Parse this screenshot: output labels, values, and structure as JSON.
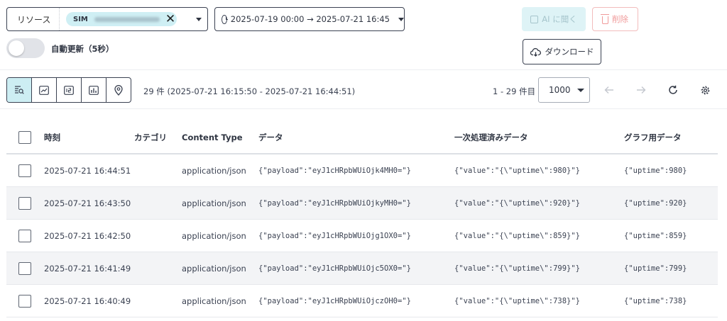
{
  "filters": {
    "resource_label": "リソース",
    "resource_chip": "SIM",
    "date_range": "2025-07-19 00:00 → 2025-07-21 16:45",
    "auto_refresh_label": "自動更新（5秒）",
    "auto_refresh_on": false
  },
  "actions": {
    "ai_label": "AI に聞く",
    "delete_label": "削除",
    "download_label": "ダウンロード"
  },
  "toolbar": {
    "views": [
      {
        "icon": "log-search-icon",
        "active": true
      },
      {
        "icon": "line-chart-icon",
        "active": false
      },
      {
        "icon": "number-card-icon",
        "active": false
      },
      {
        "icon": "bar-chart-icon",
        "active": false
      },
      {
        "icon": "map-pin-icon",
        "active": false
      }
    ],
    "summary": "29 件 (2025-07-21 16:15:50 - 2025-07-21 16:44:51)",
    "range": "1 - 29 件目",
    "page_size": "1000"
  },
  "table": {
    "headers": {
      "time": "時刻",
      "category": "カテゴリ",
      "content_type": "Content Type",
      "data": "データ",
      "processed": "一次処理済みデータ",
      "graph": "グラフ用データ"
    },
    "rows": [
      {
        "time": "2025-07-21 16:44:51",
        "category": "",
        "content_type": "application/json",
        "data": "{\"payload\":\"eyJ1cHRpbWUiOjk4MH0=\"}",
        "processed": "{\"value\":\"{\\\"uptime\\\":980}\"}",
        "graph": "{\"uptime\":980}"
      },
      {
        "time": "2025-07-21 16:43:50",
        "category": "",
        "content_type": "application/json",
        "data": "{\"payload\":\"eyJ1cHRpbWUiOjkyMH0=\"}",
        "processed": "{\"value\":\"{\\\"uptime\\\":920}\"}",
        "graph": "{\"uptime\":920}"
      },
      {
        "time": "2025-07-21 16:42:50",
        "category": "",
        "content_type": "application/json",
        "data": "{\"payload\":\"eyJ1cHRpbWUiOjg1OX0=\"}",
        "processed": "{\"value\":\"{\\\"uptime\\\":859}\"}",
        "graph": "{\"uptime\":859}"
      },
      {
        "time": "2025-07-21 16:41:49",
        "category": "",
        "content_type": "application/json",
        "data": "{\"payload\":\"eyJ1cHRpbWUiOjc5OX0=\"}",
        "processed": "{\"value\":\"{\\\"uptime\\\":799}\"}",
        "graph": "{\"uptime\":799}"
      },
      {
        "time": "2025-07-21 16:40:49",
        "category": "",
        "content_type": "application/json",
        "data": "{\"payload\":\"eyJ1cHRpbWUiOjczOH0=\"}",
        "processed": "{\"value\":\"{\\\"uptime\\\":738}\"}",
        "graph": "{\"uptime\":738}"
      }
    ]
  },
  "colors": {
    "accent": "#cdeef3",
    "border": "#3b4252",
    "danger": "#f09a9a",
    "row_alt": "#f3f4f6"
  }
}
